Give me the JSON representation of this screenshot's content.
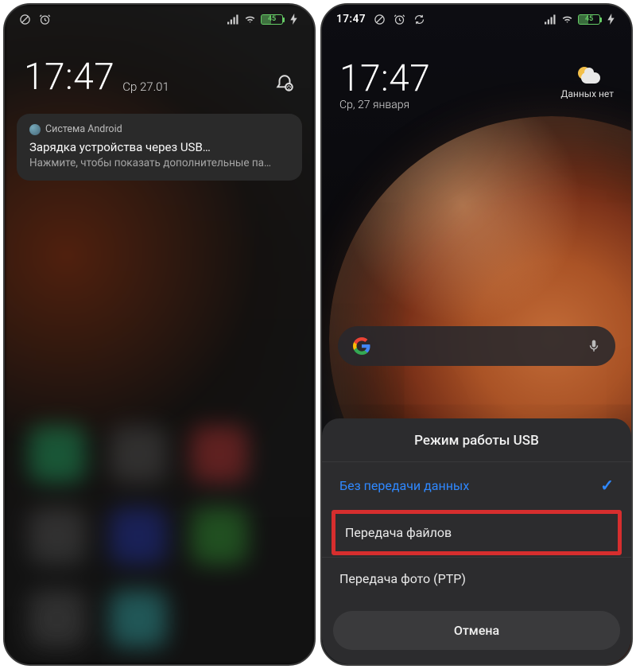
{
  "left": {
    "status": {
      "time": "",
      "battery_text": "45"
    },
    "lock": {
      "time": "17:47",
      "date": "Ср 27.01"
    },
    "notification": {
      "app_name": "Система Android",
      "title": "Зарядка устройства через USB…",
      "body": "Нажмите, чтобы показать дополнительные па…"
    }
  },
  "right": {
    "status": {
      "time": "17:47",
      "battery_text": "45"
    },
    "home": {
      "time": "17:47",
      "date": "Ср, 27 января"
    },
    "weather": {
      "label": "Данных нет"
    },
    "sheet": {
      "title": "Режим работы USB",
      "option_no_data": "Без передачи данных",
      "option_file_transfer": "Передача файлов",
      "option_ptp": "Передача фото (PTP)",
      "cancel": "Отмена"
    }
  }
}
